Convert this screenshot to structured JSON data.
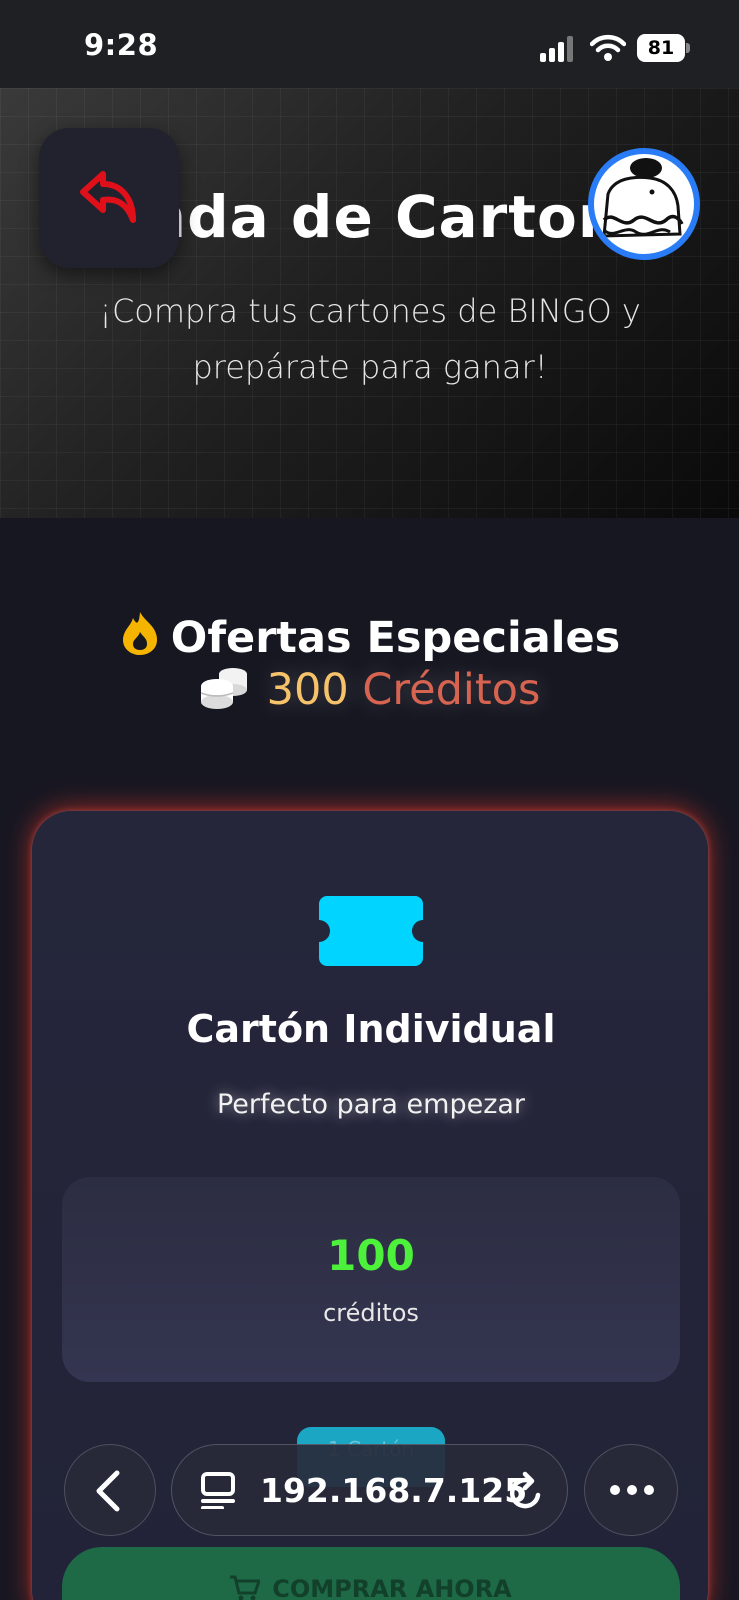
{
  "status_bar": {
    "time": "9:28",
    "battery": "81"
  },
  "hero": {
    "title": "Tienda de Cartones",
    "subtitle": "¡Compra tus cartones de BINGO y prepárate para ganar!"
  },
  "offers": {
    "section_title": "Ofertas Especiales",
    "credits_amount": "300",
    "credits_unit": "Créditos"
  },
  "card": {
    "title": "Cartón Individual",
    "description": "Perfecto para empezar",
    "price_value": "100",
    "price_unit": "créditos",
    "quantity_label": "1 Cartón",
    "buy_label": "COMPRAR AHORA"
  },
  "browser": {
    "url": "192.168.7.125"
  },
  "colors": {
    "accent_green": "#4df03a",
    "credits_gold": "#f6c36a",
    "credits_red": "#d76450",
    "ticket_cyan": "#00d4ff",
    "back_arrow_red": "#e0101a"
  }
}
